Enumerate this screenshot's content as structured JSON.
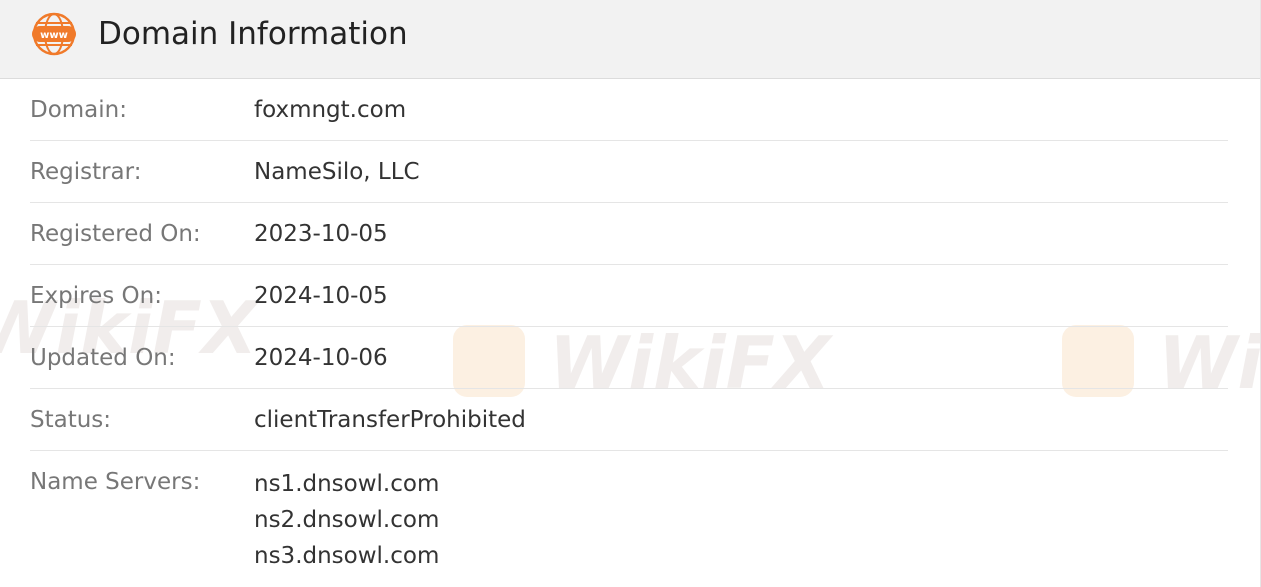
{
  "header": {
    "icon": "www-globe-icon",
    "title": "Domain Information"
  },
  "rows": [
    {
      "label": "Domain:",
      "value": "foxmngt.com"
    },
    {
      "label": "Registrar:",
      "value": "NameSilo, LLC"
    },
    {
      "label": "Registered On:",
      "value": "2023-10-05"
    },
    {
      "label": "Expires On:",
      "value": "2024-10-05"
    },
    {
      "label": "Updated On:",
      "value": "2024-10-06"
    },
    {
      "label": "Status:",
      "value": "clientTransferProhibited"
    }
  ],
  "name_servers": {
    "label": "Name Servers:",
    "values": [
      "ns1.dnsowl.com",
      "ns2.dnsowl.com",
      "ns3.dnsowl.com"
    ]
  },
  "watermark": {
    "text": "WikiFX"
  },
  "colors": {
    "header_bg": "#f2f2f2",
    "icon_accent": "#f07a2a",
    "label": "#777777",
    "value": "#333333",
    "divider": "#e5e5e5"
  }
}
